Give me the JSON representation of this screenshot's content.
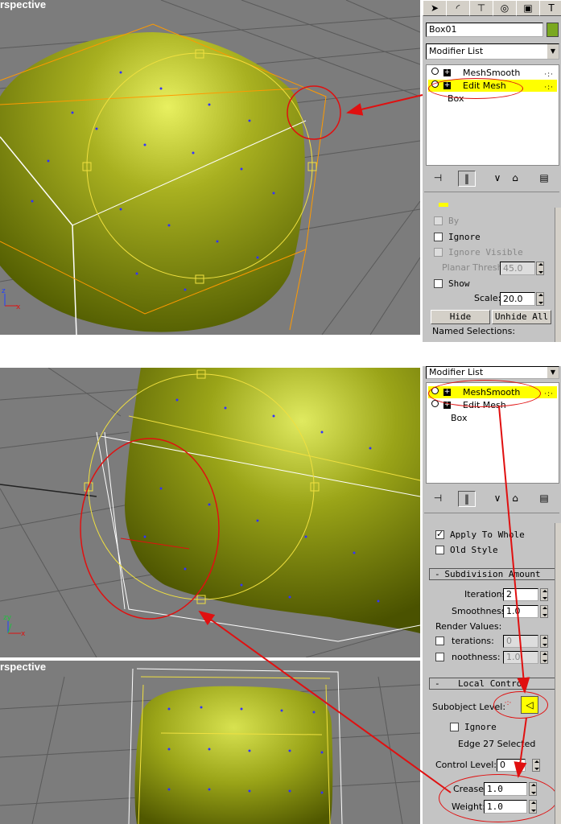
{
  "top": {
    "viewport_label": "rspective",
    "panel": {
      "object_name": "Box01",
      "object_color": "#7aa820",
      "modifier_list": "Modifier List",
      "stack": [
        "MeshSmooth",
        "Edit Mesh",
        "Box"
      ],
      "by_label": "By",
      "ignore_label": "Ignore",
      "ignore_visible_label": "Ignore Visible",
      "planar_thresh_label": "Planar Thresh:",
      "planar_thresh_value": "45.0",
      "show_label": "Show",
      "scale_label": "Scale:",
      "scale_value": "20.0",
      "hide_label": "Hide",
      "unhide_all_label": "Unhide All",
      "named_selections_label": "Named Selections:"
    }
  },
  "bottom": {
    "viewport_label": "rspective",
    "panel": {
      "modifier_list": "Modifier List",
      "stack": [
        "MeshSmooth",
        "Edit Mesh",
        "Box"
      ],
      "apply_to_whole_label": "Apply To Whole",
      "old_style_label": "Old Style",
      "subdivision_amount_label": "Subdivision Amount",
      "iterations_label": "Iterations:",
      "iterations_value": "2",
      "smoothness_label": "Smoothness:",
      "smoothness_value": "1.0",
      "render_values_label": "Render Values:",
      "render_iterations_label": "terations:",
      "render_iterations_value": "0",
      "render_smoothness_label": "noothness:",
      "render_smoothness_value": "1.0",
      "local_control_label": "Local Control",
      "subobject_level_label": "Subobject Level:",
      "ignore_label": "Ignore",
      "edge_selected_label": "Edge 27 Selected",
      "control_level_label": "Control Level:",
      "control_level_value": "0",
      "crease_label": "Crease:",
      "crease_value": "1.0",
      "weight_label": "Weight:",
      "weight_value": "1.0"
    }
  },
  "icons": {
    "tabs": [
      "create-icon",
      "modify-icon",
      "hierarchy-icon",
      "motion-icon",
      "display-icon",
      "utilities-icon"
    ],
    "stack_tools": [
      "pin-stack-icon",
      "show-end-result-icon",
      "make-unique-icon",
      "remove-modifier-icon",
      "configure-sets-icon"
    ]
  },
  "colors": {
    "mesh": "#8c9a0c",
    "highlight": "#ffff00",
    "annotation": "#e01010",
    "viewport_bg": "#7c7c7c",
    "panel_bg": "#c4c4c4"
  }
}
